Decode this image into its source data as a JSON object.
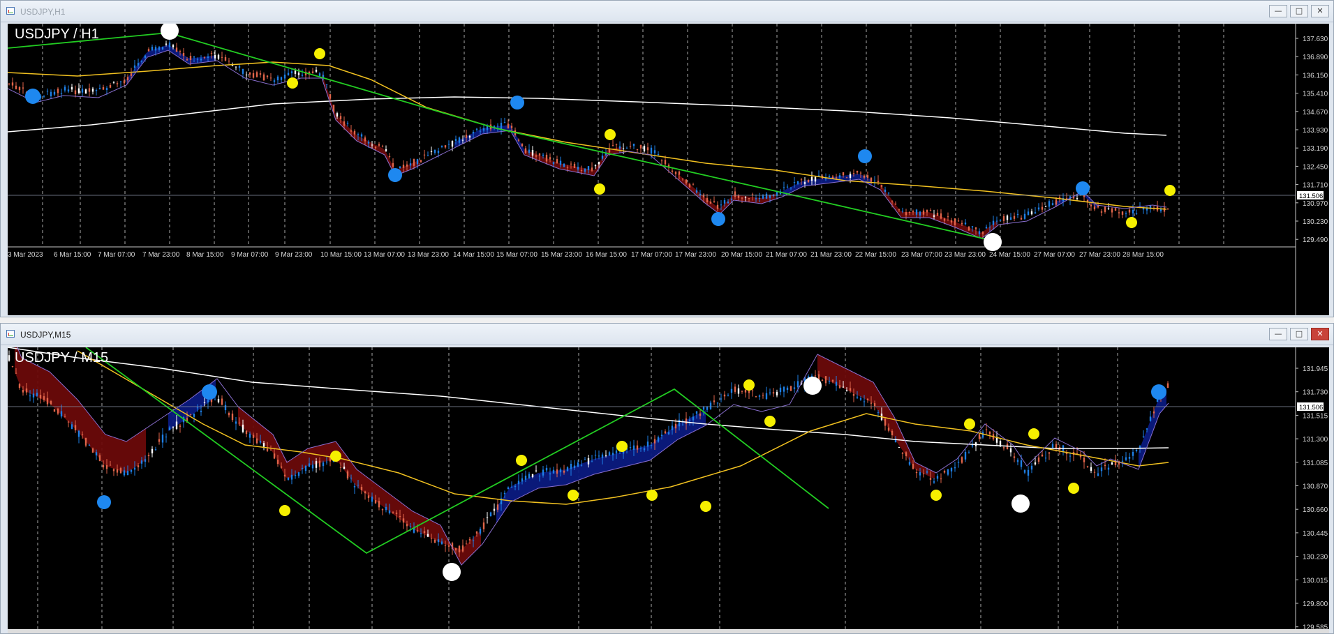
{
  "windows": [
    {
      "title": "USDJPY,H1",
      "chart_label": "USDJPY / H1",
      "current_price": "131.506",
      "price_ticks": [
        "137.630",
        "136.890",
        "136.150",
        "135.410",
        "134.670",
        "133.930",
        "133.190",
        "132.450",
        "131.710",
        "130.970",
        "130.230",
        "129.490"
      ],
      "time_ticks": [
        "3 Mar 2023",
        "6 Mar 15:00",
        "7 Mar 07:00",
        "7 Mar 23:00",
        "8 Mar 15:00",
        "9 Mar 07:00",
        "9 Mar 23:00",
        "10 Mar 15:00",
        "13 Mar 07:00",
        "13 Mar 23:00",
        "14 Mar 15:00",
        "15 Mar 07:00",
        "15 Mar 23:00",
        "16 Mar 15:00",
        "17 Mar 07:00",
        "17 Mar 23:00",
        "20 Mar 15:00",
        "21 Mar 07:00",
        "21 Mar 23:00",
        "22 Mar 15:00",
        "23 Mar 07:00",
        "23 Mar 23:00",
        "24 Mar 15:00",
        "27 Mar 07:00",
        "27 Mar 23:00",
        "28 Mar 15:00"
      ]
    },
    {
      "title": "USDJPY,M15",
      "chart_label": "USDJPY / M15",
      "current_price": "131.506",
      "price_ticks": [
        "131.945",
        "131.730",
        "131.515",
        "131.300",
        "131.085",
        "130.870",
        "130.660",
        "130.445",
        "130.230",
        "130.015",
        "129.800",
        "129.585"
      ]
    }
  ],
  "window_buttons": {
    "minimize": "—",
    "maximize": "□",
    "close": "✕"
  },
  "colors": {
    "background": "#000000",
    "bull": "#1e7fe6",
    "bear": "#e0654a",
    "doji": "#ffffff",
    "ma_slow": "#ffffff",
    "ma_mid": "#f0c020",
    "trend": "#22cc22",
    "cloud_bear": "#6a0a0a",
    "cloud_bull": "#0b1a80",
    "dot_blue": "#1e88f0",
    "dot_yellow": "#f6f000",
    "dot_white": "#ffffff"
  }
}
